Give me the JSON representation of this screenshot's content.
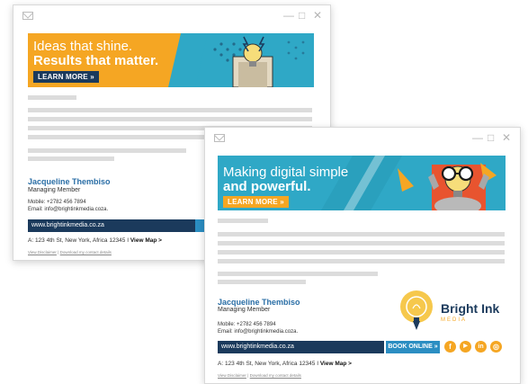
{
  "window_controls": {
    "minimize": "—",
    "maximize": "□",
    "close": "✕"
  },
  "win1": {
    "banner": {
      "line1": "Ideas that shine.",
      "line2": "Results that matter.",
      "cta": "LEARN MORE »"
    },
    "name": "Jacqueline Thembiso",
    "role": "Managing Member",
    "mobile": "Mobile: +2782 456 7894",
    "email": "Email: info@brightinkmedia.coza.",
    "website": "www.brightinkmedia.co.za",
    "address": "A: 123 4th St, New York, Africa 12345",
    "separator": "I",
    "view_map": "View Map >",
    "disclaimer": "View Disclaimer",
    "link_sep": "|",
    "download": "Download my contact details"
  },
  "win2": {
    "banner": {
      "line1": "Making digital simple",
      "line2": "and powerful.",
      "cta": "LEARN MORE »"
    },
    "name": "Jacqueline Thembiso",
    "role": "Managing Member",
    "mobile": "Mobile: +2782 456 7894",
    "email": "Email: info@brightinkmedia.coza.",
    "website": "www.brightinkmedia.co.za",
    "book": "BOOK ONLINE »",
    "address": "A: 123 4th St, New York, Africa 12345",
    "separator": "I",
    "view_map": "View Map >",
    "disclaimer": "View Disclaimer",
    "link_sep": "|",
    "download": "Download my contact details",
    "brand_name": "Bright Ink",
    "brand_sub": "MEDIA",
    "social": {
      "facebook": "f",
      "youtube": "▶",
      "linkedin": "in",
      "instagram": "◎"
    }
  },
  "colors": {
    "navy": "#1b3a5c",
    "teal": "#2fa8c6",
    "orange": "#f5a623",
    "blue": "#2b8ec2",
    "name_blue": "#2a6ea6"
  }
}
